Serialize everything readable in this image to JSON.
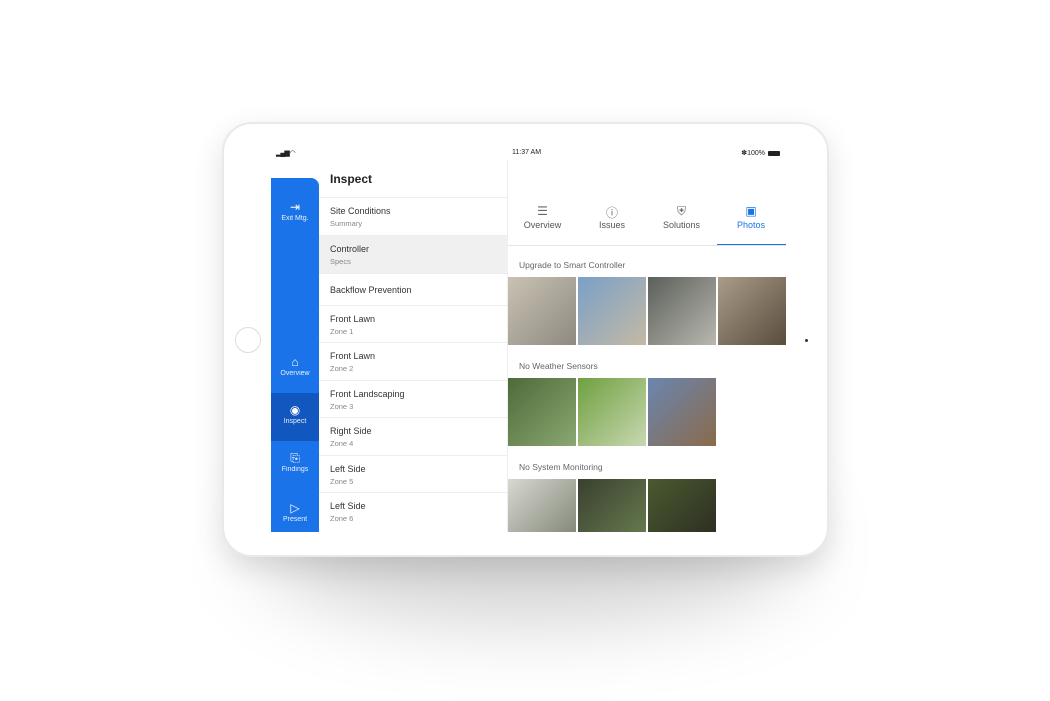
{
  "status": {
    "signal": "signal-wifi-icon",
    "time": "11:37 AM",
    "battery": "✽100%"
  },
  "sidebar": {
    "items": [
      {
        "label": "Exit Mtg.",
        "icon": "exit-icon",
        "glyph": "⇥"
      },
      {
        "label": "Overview",
        "icon": "home-icon",
        "glyph": "⌂"
      },
      {
        "label": "Inspect",
        "icon": "eye-icon",
        "glyph": "◉",
        "active": true
      },
      {
        "label": "Findings",
        "icon": "document-search-icon",
        "glyph": "⎘"
      },
      {
        "label": "Present",
        "icon": "play-icon",
        "glyph": "▷"
      }
    ]
  },
  "list": {
    "title": "Inspect",
    "items": [
      {
        "title": "Site Conditions",
        "subtitle": "Summary"
      },
      {
        "title": "Controller",
        "subtitle": "Specs",
        "selected": true
      },
      {
        "title": "Backflow Prevention",
        "subtitle": ""
      },
      {
        "title": "Front Lawn",
        "subtitle": "Zone 1"
      },
      {
        "title": "Front Lawn",
        "subtitle": "Zone 2"
      },
      {
        "title": "Front Landscaping",
        "subtitle": "Zone 3"
      },
      {
        "title": "Right Side",
        "subtitle": "Zone 4"
      },
      {
        "title": "Left Side",
        "subtitle": "Zone 5"
      },
      {
        "title": "Left Side",
        "subtitle": "Zone 6"
      }
    ]
  },
  "tabs": [
    {
      "label": "Overview",
      "icon": "checklist-icon",
      "glyph": "☰"
    },
    {
      "label": "Issues",
      "icon": "alert-circle-icon",
      "glyph": "ⓘ"
    },
    {
      "label": "Solutions",
      "icon": "shield-check-icon",
      "glyph": "⛨"
    },
    {
      "label": "Photos",
      "icon": "image-icon",
      "glyph": "▣",
      "active": true
    }
  ],
  "sections": [
    {
      "title": "Upgrade to Smart Controller",
      "photos": 4
    },
    {
      "title": "No Weather Sensors",
      "photos": 3
    },
    {
      "title": "No System Monitoring",
      "photos": 3
    }
  ],
  "colors": {
    "accent": "#1a73e8",
    "sidebar_active": "#1257bf"
  }
}
